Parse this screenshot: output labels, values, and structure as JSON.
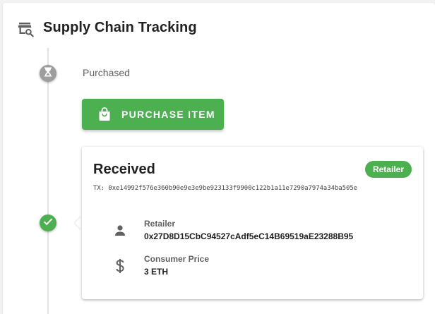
{
  "header": {
    "title": "Supply Chain Tracking",
    "icon": "shop-search-icon"
  },
  "timeline": {
    "pending_step": {
      "label": "Purchased",
      "icon": "hourglass-icon",
      "color": "#9e9e9e",
      "action_button": {
        "label": "PURCHASE ITEM",
        "icon": "shopping-bag-icon",
        "color": "#4caf50"
      }
    },
    "completed_step": {
      "icon": "check-icon",
      "color": "#4caf50",
      "card": {
        "title": "Received",
        "badge": "Retailer",
        "tx": "TX: 0xe14992f576e360b90e9e3e9be923133f9900c122b1a11e7290a7974a34ba505e",
        "fields": [
          {
            "label": "Retailer",
            "value": "0x27D8D15CbC94527cAdf5eC14B69519aE23288B95",
            "icon": "person-icon"
          },
          {
            "label": "Consumer Price",
            "value": "3 ETH",
            "icon": "dollar-icon"
          }
        ]
      }
    }
  }
}
